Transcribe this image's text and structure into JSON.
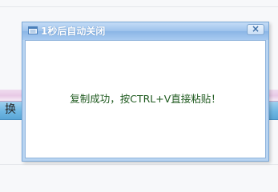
{
  "background": {
    "tab_label": "换"
  },
  "dialog": {
    "title": "1秒后自动关闭",
    "close_label": "×",
    "message": "复制成功，按CTRL+V直接粘贴！",
    "icon": "window-icon"
  },
  "colors": {
    "title_bar": "#9cc2ec",
    "message_text": "#1f5a1f",
    "bg_bar": "#6fb7e3"
  }
}
